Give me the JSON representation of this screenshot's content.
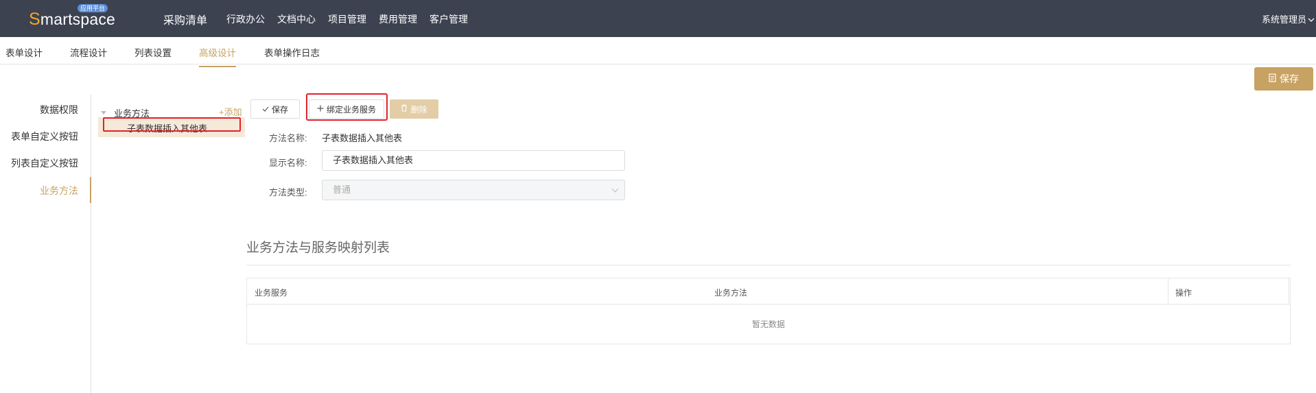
{
  "header": {
    "logo_initial": "S",
    "logo_rest": "martspace",
    "logo_badge": "应用平台",
    "app_title": "采购清单",
    "nav": [
      "行政办公",
      "文档中心",
      "项目管理",
      "费用管理",
      "客户管理"
    ],
    "user": "系统管理员"
  },
  "tabs": [
    "表单设计",
    "流程设计",
    "列表设置",
    "高级设计",
    "表单操作日志"
  ],
  "active_tab": "高级设计",
  "top_save_label": "保存",
  "left_menu": [
    "数据权限",
    "表单自定义按钮",
    "列表自定义按钮",
    "业务方法"
  ],
  "active_left_menu": "业务方法",
  "tree": {
    "root_label": "业务方法",
    "add_label": "+添加",
    "selected_node": "子表数据插入其他表"
  },
  "toolbar": {
    "save_label": "保存",
    "bind_label": "绑定业务服务",
    "delete_label": "删除"
  },
  "form": {
    "method_name_label": "方法名称:",
    "method_name_value": "子表数据插入其他表",
    "display_name_label": "显示名称:",
    "display_name_value": "子表数据插入其他表",
    "method_type_label": "方法类型:",
    "method_type_value": "普通"
  },
  "mapping": {
    "title": "业务方法与服务映射列表",
    "columns": [
      "业务服务",
      "业务方法",
      "操作"
    ],
    "empty_text": "暂无数据"
  },
  "colors": {
    "topbar": "#3c4250",
    "accent": "#c8a263",
    "highlight_box": "#e5202b",
    "selected_node_bg": "#f5e9d8"
  }
}
